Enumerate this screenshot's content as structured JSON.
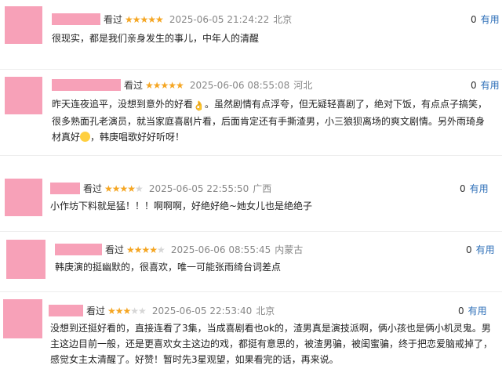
{
  "reviews": [
    {
      "seen": "看过",
      "stars": "★★★★★",
      "stars_off": "",
      "rating": 5,
      "time": "2025-06-05 21:24:22",
      "location": "北京",
      "useful_count": "0",
      "useful_label": "有用",
      "content_parts": [
        "很现实，都是我们亲身发生的事儿，中年人的清醒"
      ]
    },
    {
      "seen": "看过",
      "stars": "★★★★★",
      "stars_off": "",
      "rating": 5,
      "time": "2025-06-06 08:55:08",
      "location": "河北",
      "useful_count": "0",
      "useful_label": "有用",
      "content_parts": [
        "昨天连夜追平，没想到意外的好看",
        "。虽然剧情有点浮夸，但无疑轻喜剧了，绝对下饭，有点点子搞笑，很多熟面孔老演员，就当家庭喜剧片看，后面肯定还有手撕渣男，小三狼狈离场的爽文剧情。另外雨琦身材真好",
        "，韩庚唱歌好好听呀！"
      ]
    },
    {
      "seen": "看过",
      "stars": "★★★★",
      "stars_off": "★",
      "rating": 4,
      "time": "2025-06-05 22:55:50",
      "location": "广西",
      "useful_count": "0",
      "useful_label": "有用",
      "content_parts": [
        "小作坊下料就是猛！！！啊啊啊，好绝好绝~她女儿也是绝绝子"
      ]
    },
    {
      "seen": "看过",
      "stars": "★★★★",
      "stars_off": "★",
      "rating": 4,
      "time": "2025-06-06 08:55:45",
      "location": "内蒙古",
      "useful_count": "0",
      "useful_label": "有用",
      "content_parts": [
        "韩庚演的挺幽默的，很喜欢，唯一可能张雨绮台词差点"
      ]
    },
    {
      "seen": "看过",
      "stars": "★★★",
      "stars_off": "★★",
      "rating": 3,
      "time": "2025-06-05 22:53:40",
      "location": "北京",
      "useful_count": "0",
      "useful_label": "有用",
      "content_parts": [
        "没想到还挺好看的，直接连看了3集，当成喜剧看也ok的，渣男真是演技派啊，俩小孩也是俩小机灵鬼。男主这边目前一般，还是更喜欢女主这边的戏，都挺有意思的，被渣男骗，被闺蜜骗，终于把恋爱脑戒掉了，感觉女主太清醒了。好赞！暂时先3星观望，如果看完的话，再来说。"
      ]
    }
  ],
  "icons": {
    "hand": "hand-ok-icon",
    "laugh": "laughing-emoji-icon"
  }
}
